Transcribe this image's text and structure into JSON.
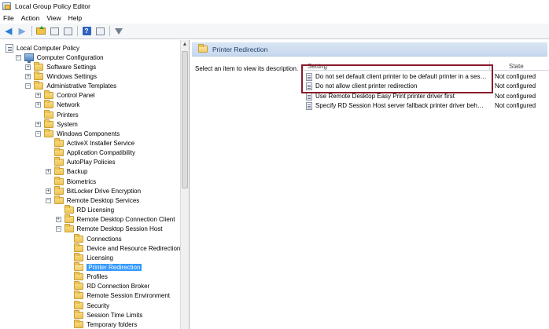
{
  "window": {
    "title": "Local Group Policy Editor"
  },
  "menu": [
    "File",
    "Action",
    "View",
    "Help"
  ],
  "toolbar": {
    "help_label": "?"
  },
  "tree": [
    {
      "label": "Local Computer Policy",
      "level": 0,
      "expander": "none",
      "icon": "doc"
    },
    {
      "label": "Computer Configuration",
      "level": 1,
      "expander": "-",
      "icon": "computer"
    },
    {
      "label": "Software Settings",
      "level": 2,
      "expander": "+",
      "icon": "folder"
    },
    {
      "label": "Windows Settings",
      "level": 2,
      "expander": "+",
      "icon": "folder"
    },
    {
      "label": "Administrative Templates",
      "level": 2,
      "expander": "-",
      "icon": "folder"
    },
    {
      "label": "Control Panel",
      "level": 3,
      "expander": "+",
      "icon": "folder"
    },
    {
      "label": "Network",
      "level": 3,
      "expander": "+",
      "icon": "folder"
    },
    {
      "label": "Printers",
      "level": 3,
      "expander": "none",
      "icon": "folder"
    },
    {
      "label": "System",
      "level": 3,
      "expander": "+",
      "icon": "folder"
    },
    {
      "label": "Windows Components",
      "level": 3,
      "expander": "-",
      "icon": "folder"
    },
    {
      "label": "ActiveX Installer Service",
      "level": 4,
      "expander": "none",
      "icon": "folder"
    },
    {
      "label": "Application Compatibility",
      "level": 4,
      "expander": "none",
      "icon": "folder"
    },
    {
      "label": "AutoPlay Policies",
      "level": 4,
      "expander": "none",
      "icon": "folder"
    },
    {
      "label": "Backup",
      "level": 4,
      "expander": "+",
      "icon": "folder"
    },
    {
      "label": "Biometrics",
      "level": 4,
      "expander": "none",
      "icon": "folder"
    },
    {
      "label": "BitLocker Drive Encryption",
      "level": 4,
      "expander": "+",
      "icon": "folder"
    },
    {
      "label": "Remote Desktop Services",
      "level": 4,
      "expander": "-",
      "icon": "folder"
    },
    {
      "label": "RD Licensing",
      "level": 5,
      "expander": "none",
      "icon": "folder"
    },
    {
      "label": "Remote Desktop Connection Client",
      "level": 5,
      "expander": "+",
      "icon": "folder"
    },
    {
      "label": "Remote Desktop Session Host",
      "level": 5,
      "expander": "-",
      "icon": "folder"
    },
    {
      "label": "Connections",
      "level": 6,
      "expander": "none",
      "icon": "folder"
    },
    {
      "label": "Device and Resource Redirection",
      "level": 6,
      "expander": "none",
      "icon": "folder"
    },
    {
      "label": "Licensing",
      "level": 6,
      "expander": "none",
      "icon": "folder"
    },
    {
      "label": "Printer Redirection",
      "level": 6,
      "expander": "none",
      "icon": "folder-open",
      "selected": true
    },
    {
      "label": "Profiles",
      "level": 6,
      "expander": "none",
      "icon": "folder"
    },
    {
      "label": "RD Connection Broker",
      "level": 6,
      "expander": "none",
      "icon": "folder"
    },
    {
      "label": "Remote Session Environment",
      "level": 6,
      "expander": "none",
      "icon": "folder"
    },
    {
      "label": "Security",
      "level": 6,
      "expander": "none",
      "icon": "folder"
    },
    {
      "label": "Session Time Limits",
      "level": 6,
      "expander": "none",
      "icon": "folder"
    },
    {
      "label": "Temporary folders",
      "level": 6,
      "expander": "none",
      "icon": "folder"
    }
  ],
  "right_pane": {
    "title": "Printer Redirection",
    "description": "Select an item to view its description.",
    "columns": {
      "setting": "Setting",
      "state": "State"
    },
    "rows": [
      {
        "setting": "Do not set default client printer to be default printer in a session",
        "state": "Not configured"
      },
      {
        "setting": "Do not allow client printer redirection",
        "state": "Not configured"
      },
      {
        "setting": "Use Remote Desktop Easy Print printer driver first",
        "state": "Not configured"
      },
      {
        "setting": "Specify RD Session Host server fallback printer driver behavior",
        "state": "Not configured"
      }
    ]
  },
  "colors": {
    "selection": "#3399ff",
    "highlight_box": "#8b1a2a",
    "header_band": "#c7d8ee"
  }
}
